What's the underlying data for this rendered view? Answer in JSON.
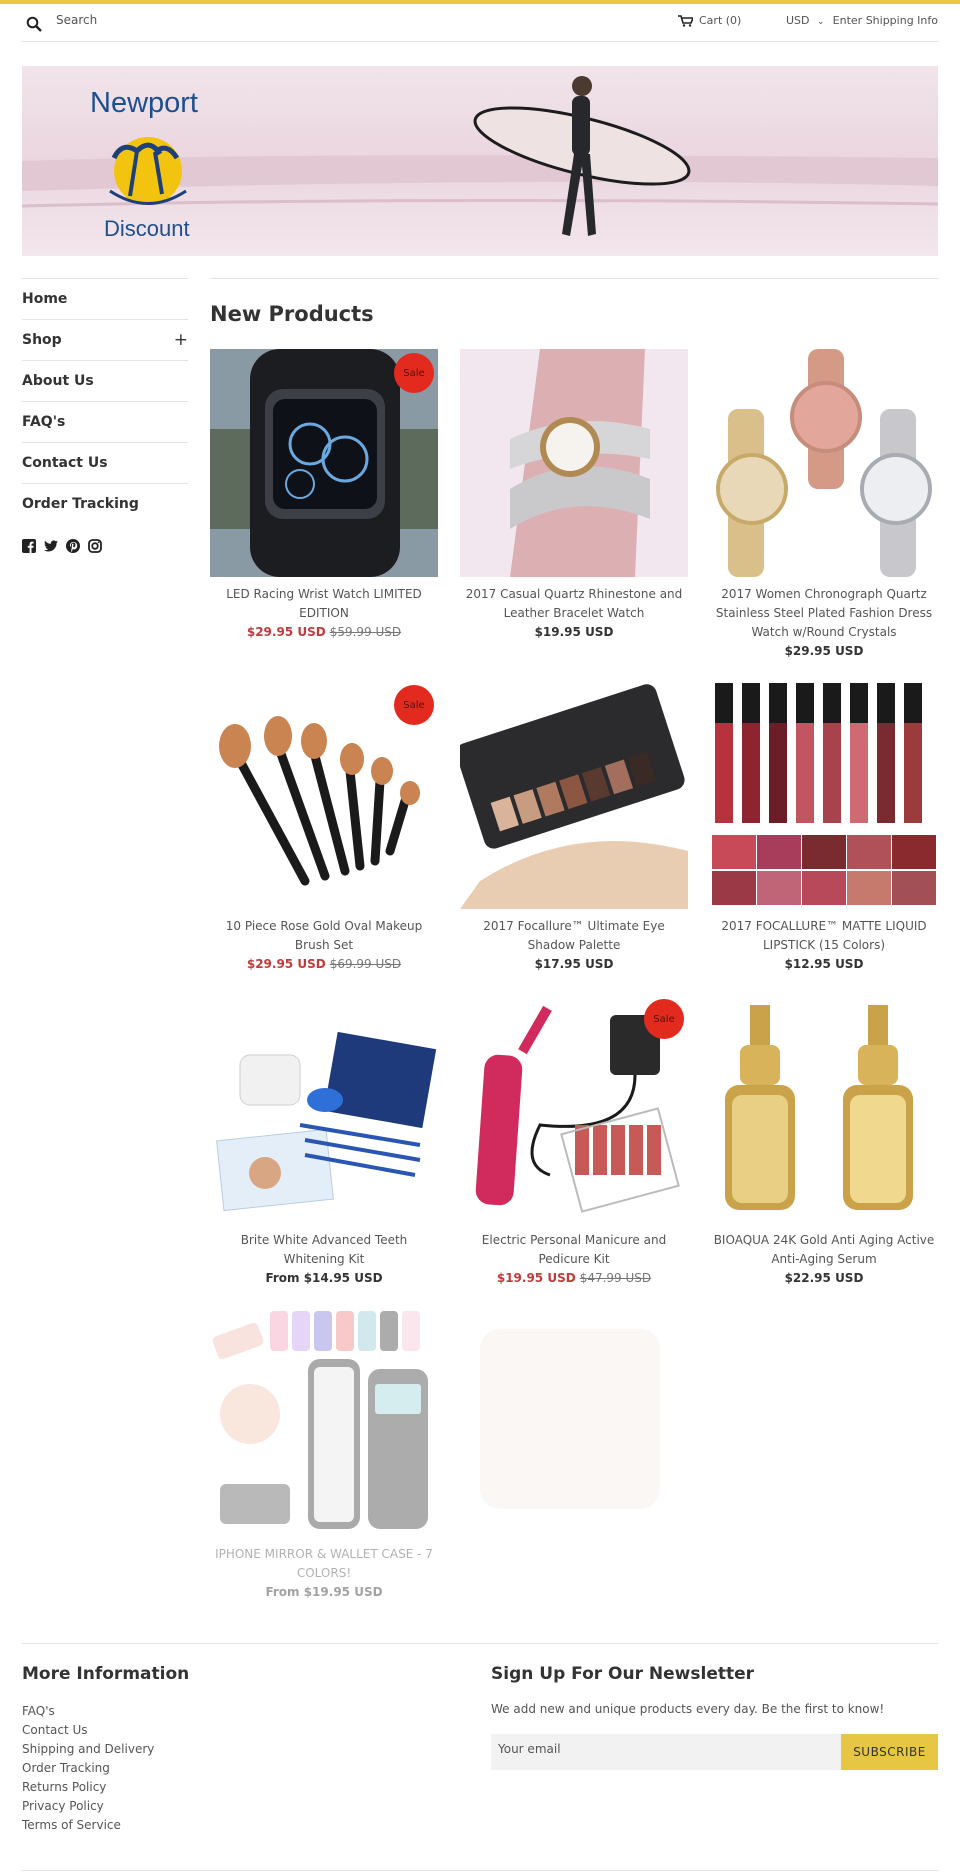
{
  "header": {
    "search_label": "Search",
    "cart_label": "Cart (0)",
    "currency": "USD",
    "shipping_label": "Enter Shipping Info",
    "accent_color": "#e6c642"
  },
  "banner": {
    "logo_top": "Newport",
    "logo_bottom": "Discount"
  },
  "sidebar": {
    "items": [
      {
        "label": "Home"
      },
      {
        "label": "Shop "
      },
      {
        "label": "About Us"
      },
      {
        "label": "FAQ's"
      },
      {
        "label": "Contact Us"
      },
      {
        "label": "Order Tracking"
      }
    ],
    "shop_expand": "+",
    "social_icons": [
      "facebook-icon",
      "twitter-icon",
      "pinterest-icon",
      "instagram-icon"
    ]
  },
  "main": {
    "section_title": "New Products",
    "sale_badge": "Sale",
    "products": [
      {
        "title": "LED Racing Wrist Watch LIMITED EDITION",
        "price": "$29.95 USD",
        "compare": "$59.99 USD",
        "sale": true
      },
      {
        "title": "2017 Casual Quartz Rhinestone and Leather Bracelet Watch",
        "price": "$19.95 USD",
        "compare": "",
        "sale": false
      },
      {
        "title": "2017 Women Chronograph Quartz Stainless Steel Plated Fashion Dress Watch w/Round Crystals",
        "price": "$29.95 USD",
        "compare": "",
        "sale": false
      },
      {
        "title": "10 Piece Rose Gold Oval Makeup Brush Set",
        "price": "$29.95 USD",
        "compare": "$69.99 USD",
        "sale": true
      },
      {
        "title": "2017 Focallure™ Ultimate Eye Shadow Palette",
        "price": "$17.95 USD",
        "compare": "",
        "sale": false
      },
      {
        "title": "2017 FOCALLURE™ MATTE LIQUID LIPSTICK (15 Colors)",
        "price": "$12.95 USD",
        "compare": "",
        "sale": false
      },
      {
        "title": "Brite White Advanced Teeth Whitening Kit",
        "price": "From $14.95 USD",
        "compare": "",
        "sale": false
      },
      {
        "title": "Electric Personal Manicure and Pedicure Kit",
        "price": "$19.95 USD",
        "compare": "$47.99 USD",
        "sale": true
      },
      {
        "title": "BIOAQUA 24K Gold Anti Aging Active Anti-Aging Serum",
        "price": "$22.95 USD",
        "compare": "",
        "sale": false
      },
      {
        "title": "IPHONE MIRROR & WALLET CASE - 7 COLORS!",
        "price": "From $19.95 USD",
        "compare": "",
        "sale": false
      }
    ]
  },
  "footer": {
    "info_title": "More Information",
    "links": [
      "FAQ's",
      "Contact Us",
      "Shipping and Delivery",
      "Order Tracking",
      "Returns Policy",
      "Privacy Policy",
      "Terms of Service"
    ],
    "newsletter_title": "Sign Up For Our Newsletter",
    "newsletter_text": "We add new and unique products every day. Be the first to know!",
    "email_placeholder": "Your email",
    "subscribe_label": "SUBSCRIBE"
  }
}
